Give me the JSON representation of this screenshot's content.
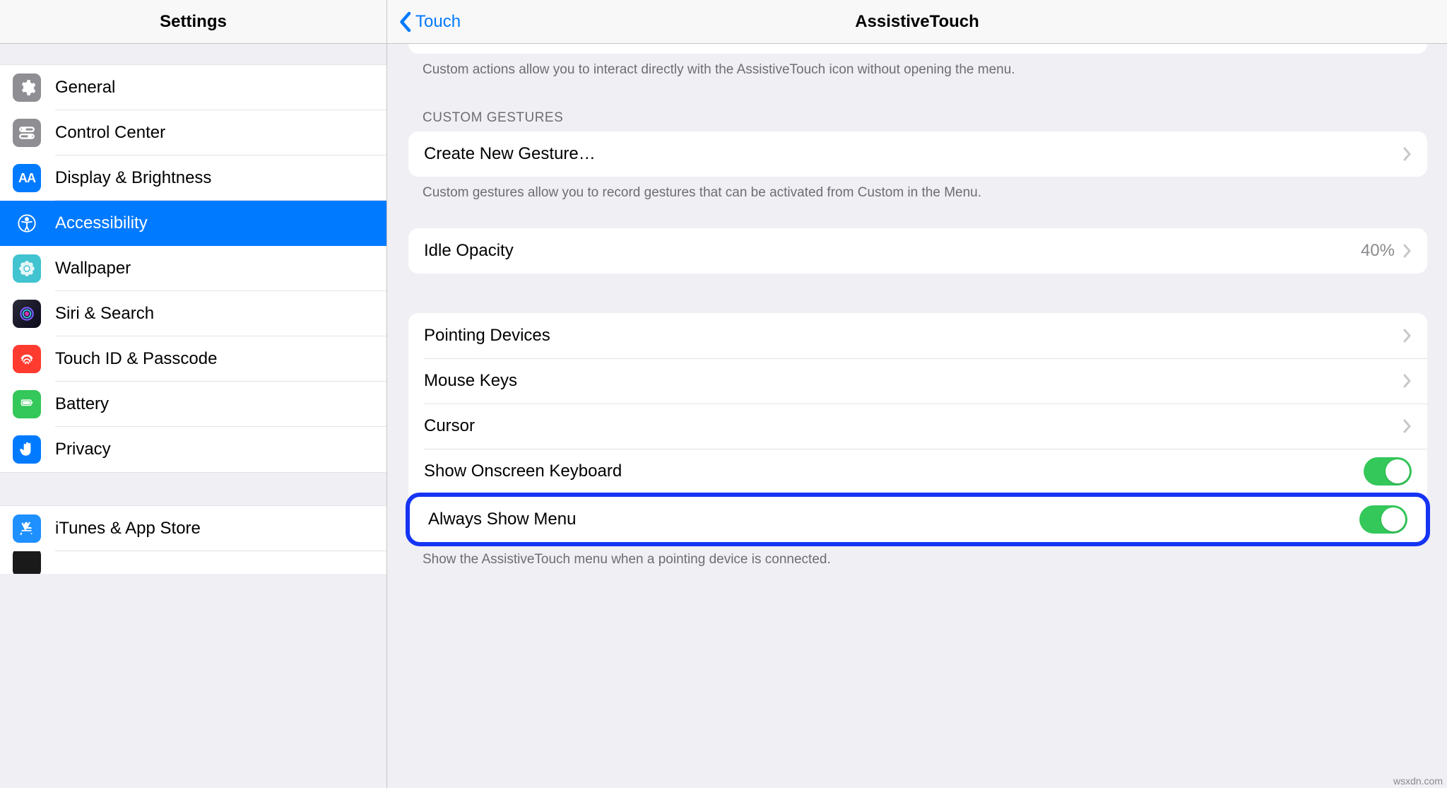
{
  "sidebar": {
    "title": "Settings",
    "items": [
      {
        "label": "General",
        "icon": "gear",
        "color": "#8e8e93"
      },
      {
        "label": "Control Center",
        "icon": "switches",
        "color": "#8e8e93"
      },
      {
        "label": "Display & Brightness",
        "icon": "aa",
        "color": "#007aff"
      },
      {
        "label": "Accessibility",
        "icon": "accessibility",
        "color": "#007aff",
        "selected": true
      },
      {
        "label": "Wallpaper",
        "icon": "flower",
        "color": "#42c3d0"
      },
      {
        "label": "Siri & Search",
        "icon": "siri",
        "color": "#1a1a1a"
      },
      {
        "label": "Touch ID & Passcode",
        "icon": "fingerprint",
        "color": "#ff3b30"
      },
      {
        "label": "Battery",
        "icon": "battery",
        "color": "#34c759"
      },
      {
        "label": "Privacy",
        "icon": "hand",
        "color": "#007aff"
      }
    ],
    "items2": [
      {
        "label": "iTunes & App Store",
        "icon": "appstore",
        "color": "#1e90ff"
      }
    ]
  },
  "nav": {
    "back": "Touch",
    "title": "AssistiveTouch"
  },
  "content": {
    "custom_actions_desc": "Custom actions allow you to interact directly with the AssistiveTouch icon without opening the menu.",
    "custom_gestures_header": "CUSTOM GESTURES",
    "create_gesture": "Create New Gesture…",
    "custom_gestures_desc": "Custom gestures allow you to record gestures that can be activated from Custom in the Menu.",
    "idle_opacity_label": "Idle Opacity",
    "idle_opacity_value": "40%",
    "pointing_devices": "Pointing Devices",
    "mouse_keys": "Mouse Keys",
    "cursor": "Cursor",
    "show_onscreen_keyboard": "Show Onscreen Keyboard",
    "always_show_menu": "Always Show Menu",
    "footer_desc": "Show the AssistiveTouch menu when a pointing device is connected."
  },
  "watermark": "wsxdn.com"
}
